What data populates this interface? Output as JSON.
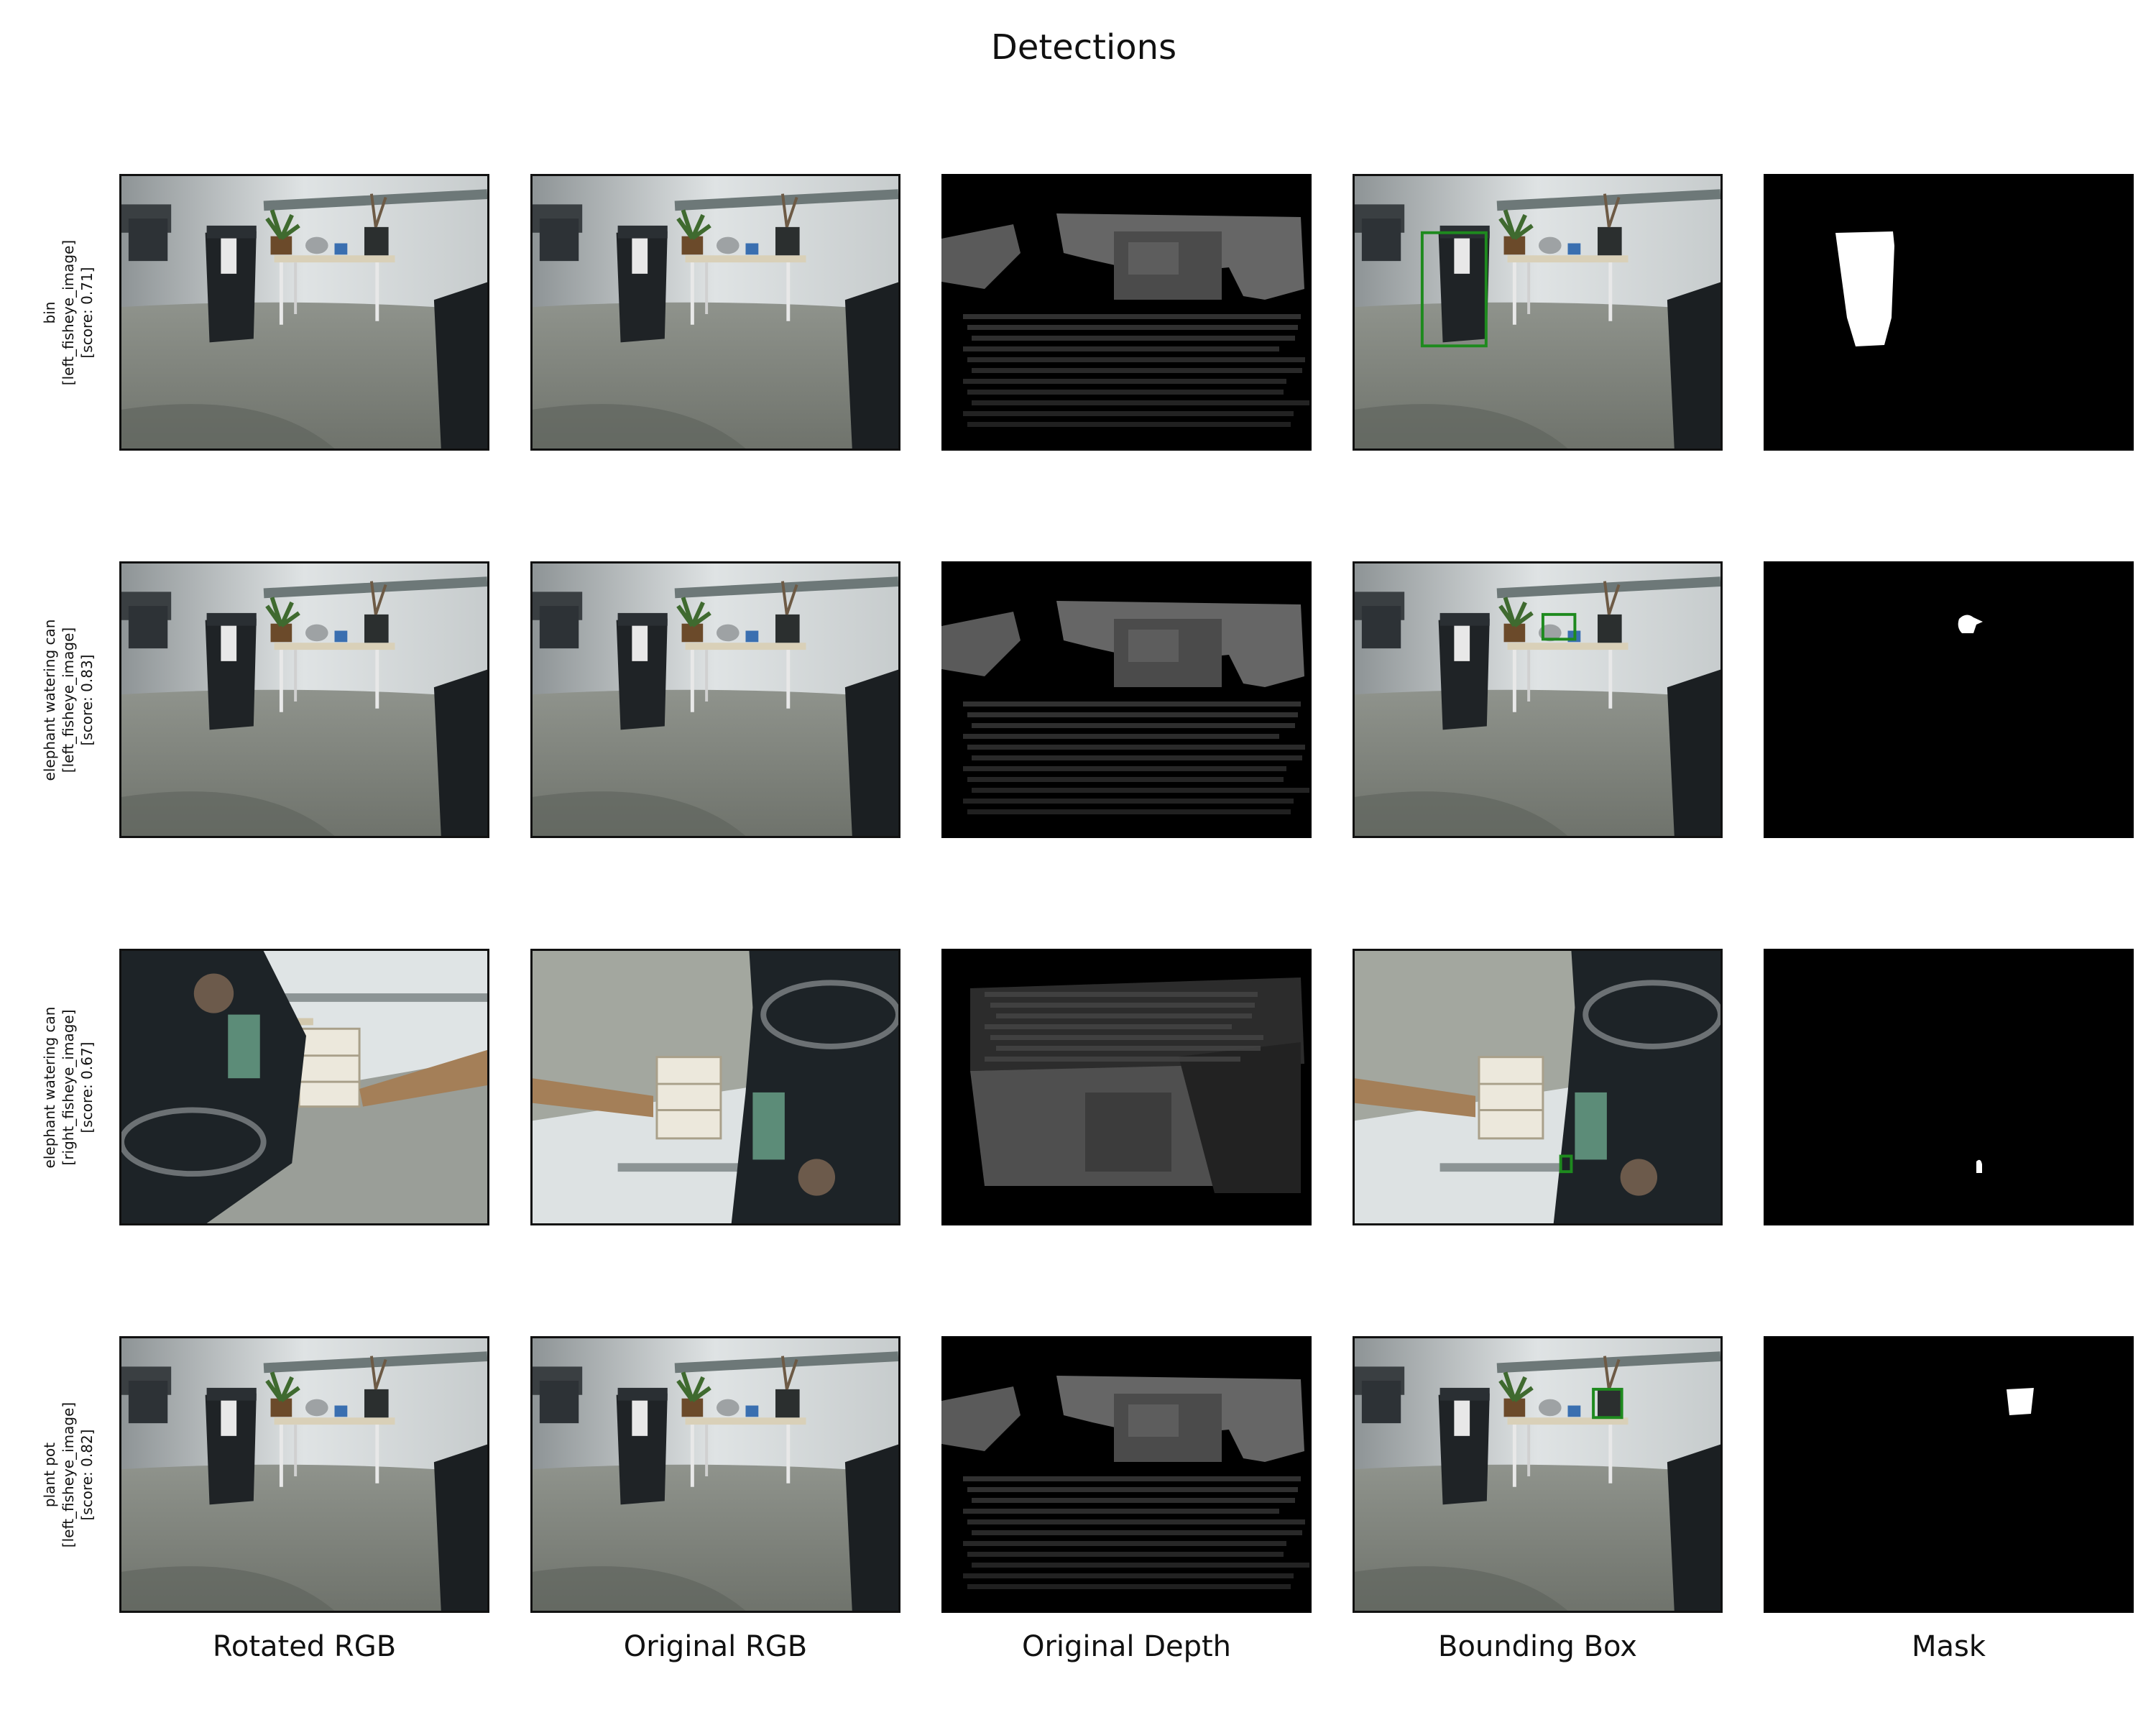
{
  "title": "Detections",
  "columns": [
    "Rotated RGB",
    "Original RGB",
    "Original Depth",
    "Bounding Box",
    "Mask"
  ],
  "rows": [
    {
      "label": "bin",
      "camera": "[left_fisheye_image]",
      "score": "[score: 0.71]",
      "scene": "lab_left",
      "box_color": "#1e8a1e"
    },
    {
      "label": "elephant watering can",
      "camera": "[left_fisheye_image]",
      "score": "[score: 0.83]",
      "scene": "lab_left",
      "box_color": "#1e8a1e"
    },
    {
      "label": "elephant watering can",
      "camera": "[right_fisheye_image]",
      "score": "[score: 0.67]",
      "scene": "lab_right",
      "box_color": "#1e8a1e"
    },
    {
      "label": "plant pot",
      "camera": "[left_fisheye_image]",
      "score": "[score: 0.82]",
      "scene": "lab_left",
      "box_color": "#1e8a1e"
    }
  ]
}
